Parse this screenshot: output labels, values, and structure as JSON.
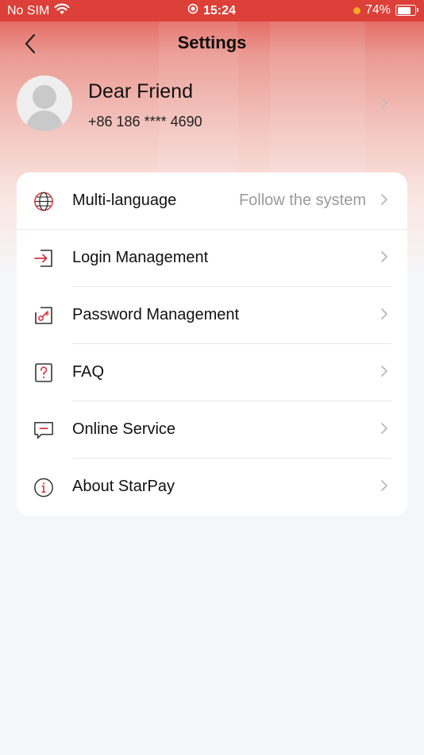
{
  "status_bar": {
    "carrier": "No SIM",
    "time": "15:24",
    "battery": "74%"
  },
  "header": {
    "title": "Settings"
  },
  "profile": {
    "name": "Dear Friend",
    "phone": "+86 186 **** 4690"
  },
  "menu": {
    "items": [
      {
        "label": "Multi-language",
        "value": "Follow the system",
        "icon": "globe-icon"
      },
      {
        "label": "Login Management",
        "icon": "login-icon"
      },
      {
        "label": "Password Management",
        "icon": "key-icon"
      },
      {
        "label": "FAQ",
        "icon": "question-icon"
      },
      {
        "label": "Online Service",
        "icon": "chat-icon"
      },
      {
        "label": "About StarPay",
        "icon": "info-icon"
      }
    ]
  },
  "colors": {
    "accent": "#dc4038",
    "icon_red": "#d9363e"
  }
}
